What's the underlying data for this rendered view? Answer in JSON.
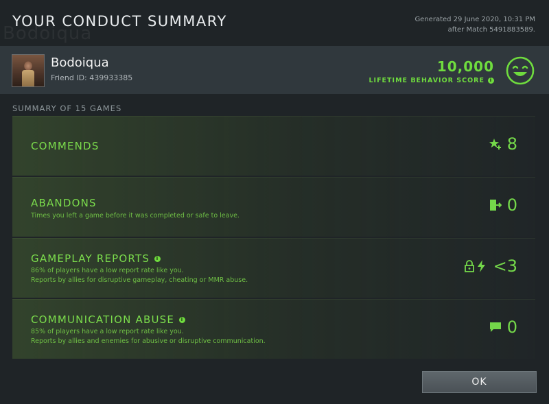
{
  "header": {
    "title": "YOUR CONDUCT SUMMARY",
    "background_name": "Bodoiqua",
    "generated_line1": "Generated 29 June 2020, 10:31 PM",
    "generated_line2": "after Match 5491883589."
  },
  "player": {
    "name": "Bodoiqua",
    "friend_id": "Friend ID: 439933385"
  },
  "behavior": {
    "score": "10,000",
    "label": "LIFETIME BEHAVIOR SCORE",
    "color": "#6fdc3e"
  },
  "summary": {
    "label": "SUMMARY OF 15 GAMES",
    "cards": [
      {
        "title": "COMMENDS",
        "desc1": "",
        "desc2": "",
        "value": "8",
        "icon": "star-plus-icon"
      },
      {
        "title": "ABANDONS",
        "desc1": "Times you left a game before it was completed or safe to leave.",
        "desc2": "",
        "value": "0",
        "icon": "exit-door-icon"
      },
      {
        "title": "GAMEPLAY REPORTS",
        "desc1": "86% of players have a low report rate like you.",
        "desc2": "Reports by allies for disruptive gameplay, cheating or MMR abuse.",
        "value": "<3",
        "icon": "lock-lightning-icon"
      },
      {
        "title": "COMMUNICATION ABUSE",
        "desc1": "85% of players have a low report rate like you.",
        "desc2": "Reports by allies and enemies for abusive or disruptive communication.",
        "value": "0",
        "icon": "chat-bubble-icon"
      }
    ]
  },
  "actions": {
    "ok_label": "OK"
  }
}
